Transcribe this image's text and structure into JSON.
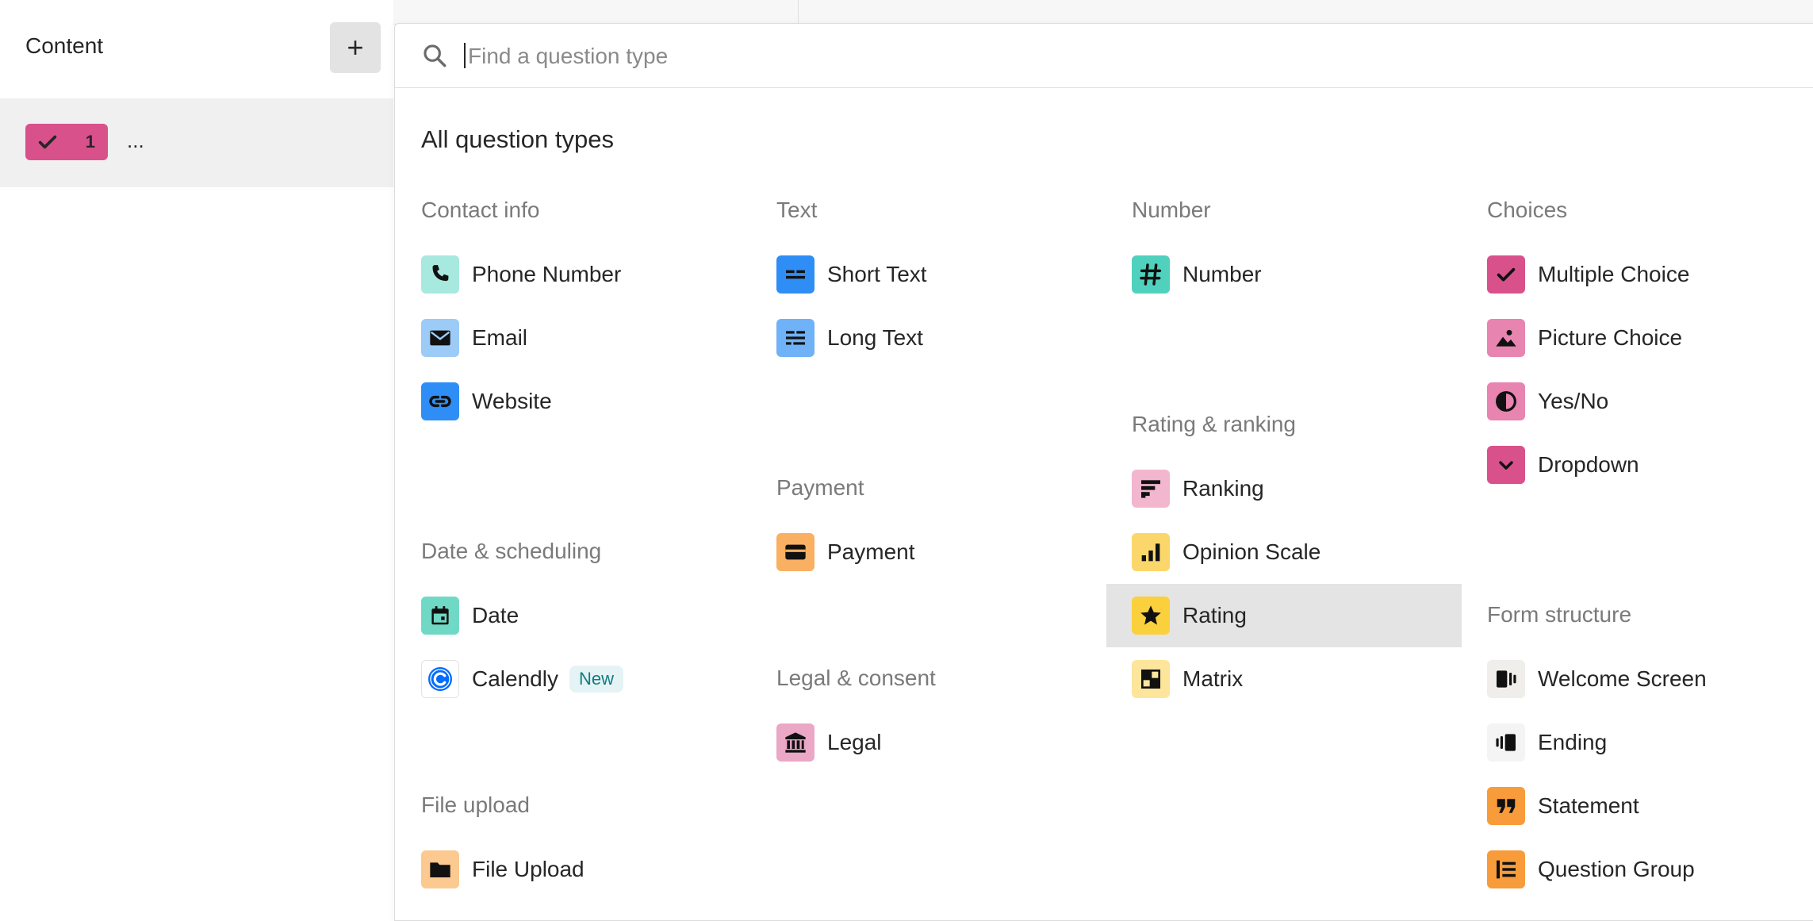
{
  "sidebar": {
    "title": "Content",
    "add_label": "+",
    "question_number": "1",
    "question_title": "..."
  },
  "search": {
    "placeholder": "Find a question type",
    "value": ""
  },
  "section_title": "All question types",
  "colors": {
    "choices_pink": "#d9518b",
    "hover_bg": "#e4e4e4",
    "new_badge_text": "#0e7c86"
  },
  "columns": [
    {
      "groups": [
        {
          "title": "Contact info",
          "items": [
            {
              "label": "Phone Number",
              "icon": "phone-icon",
              "color": "#a7e8df"
            },
            {
              "label": "Email",
              "icon": "envelope-icon",
              "color": "#9ccbf7"
            },
            {
              "label": "Website",
              "icon": "link-icon",
              "color": "#2f8ef6"
            }
          ]
        },
        {
          "title": "Date & scheduling",
          "items": [
            {
              "label": "Date",
              "icon": "calendar-icon",
              "color": "#6fd9c6"
            },
            {
              "label": "Calendly",
              "icon": "calendly-icon",
              "color": "#ffffff",
              "badge": "New"
            }
          ]
        },
        {
          "title": "File upload",
          "items": [
            {
              "label": "File Upload",
              "icon": "folder-icon",
              "color": "#fcc990"
            }
          ]
        }
      ]
    },
    {
      "groups": [
        {
          "title": "Text",
          "items": [
            {
              "label": "Short Text",
              "icon": "short-text-icon",
              "color": "#2f8ef6"
            },
            {
              "label": "Long Text",
              "icon": "long-text-icon",
              "color": "#6fb2f7"
            }
          ]
        },
        {
          "title": "Payment",
          "items": [
            {
              "label": "Payment",
              "icon": "credit-card-icon",
              "color": "#f9b062"
            }
          ]
        },
        {
          "title": "Legal & consent",
          "items": [
            {
              "label": "Legal",
              "icon": "bank-icon",
              "color": "#eba7c6"
            }
          ]
        }
      ]
    },
    {
      "groups": [
        {
          "title": "Number",
          "items": [
            {
              "label": "Number",
              "icon": "hash-icon",
              "color": "#4fd1bd"
            }
          ]
        },
        {
          "title": "Rating & ranking",
          "items": [
            {
              "label": "Ranking",
              "icon": "ranking-icon",
              "color": "#f2b6cf"
            },
            {
              "label": "Opinion Scale",
              "icon": "bar-chart-icon",
              "color": "#fbd76b"
            },
            {
              "label": "Rating",
              "icon": "star-icon",
              "color": "#fbd03d",
              "hover": true
            },
            {
              "label": "Matrix",
              "icon": "matrix-icon",
              "color": "#fde59b"
            }
          ]
        }
      ]
    },
    {
      "groups": [
        {
          "title": "Choices",
          "items": [
            {
              "label": "Multiple Choice",
              "icon": "check-icon",
              "color": "#d9518b"
            },
            {
              "label": "Picture Choice",
              "icon": "picture-icon",
              "color": "#e784b0"
            },
            {
              "label": "Yes/No",
              "icon": "half-circle-icon",
              "color": "#e784b0"
            },
            {
              "label": "Dropdown",
              "icon": "chevron-down-icon",
              "color": "#d9518b"
            }
          ]
        },
        {
          "title": "Form structure",
          "items": [
            {
              "label": "Welcome Screen",
              "icon": "welcome-screen-icon",
              "color": "#efeeea"
            },
            {
              "label": "Ending",
              "icon": "ending-icon",
              "color": "#f4f4f4"
            },
            {
              "label": "Statement",
              "icon": "quote-icon",
              "color": "#f89b3a"
            },
            {
              "label": "Question Group",
              "icon": "question-group-icon",
              "color": "#f89b3a"
            }
          ]
        }
      ]
    }
  ]
}
